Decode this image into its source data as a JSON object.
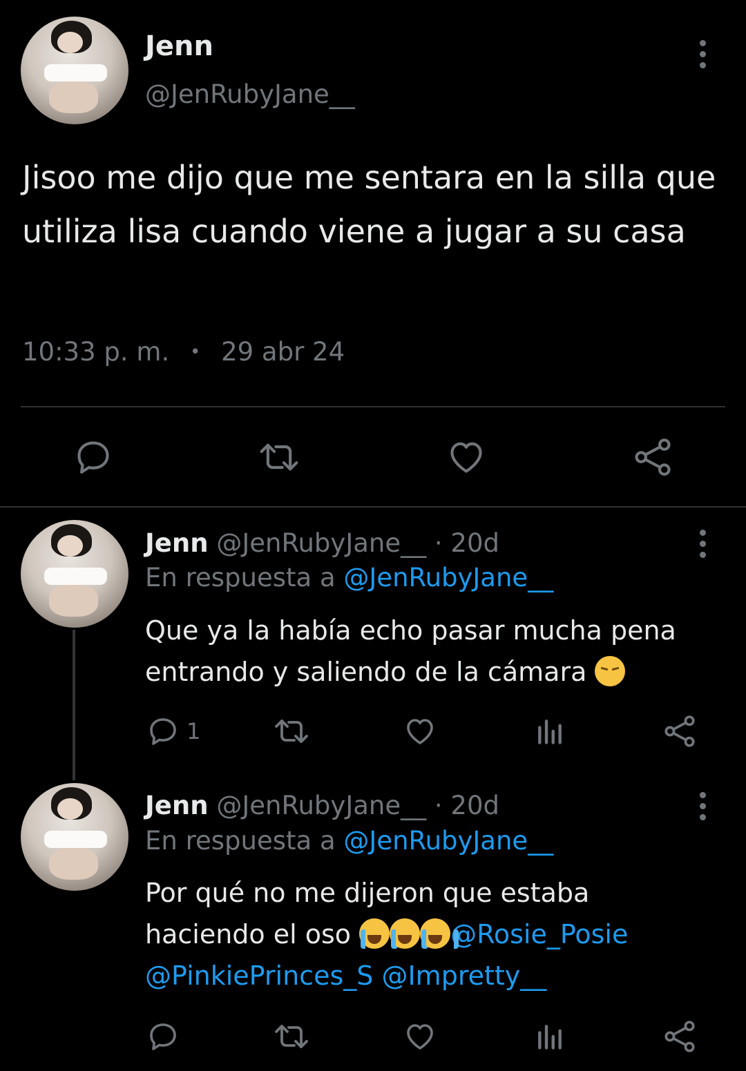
{
  "main_tweet": {
    "name": "Jenn",
    "handle": "@JenRubyJane__",
    "text": "Jisoo me dijo que me sentara en la silla que utiliza lisa cuando viene a jugar a su casa",
    "time": "10:33 p. m.",
    "separator": "•",
    "date": "29 abr 24",
    "actions": [
      "reply-icon",
      "retweet-icon",
      "like-icon",
      "share-icon"
    ]
  },
  "replies": [
    {
      "name": "Jenn",
      "handle": "@JenRubyJane__",
      "age": "· 20d",
      "replying_prefix": "En respuesta a",
      "replying_to": "@JenRubyJane__",
      "text": "Que ya la había echo pasar mucha pena entrando y saliendo de la cámara",
      "emoji": "pensive-face",
      "reply_count": "1",
      "actions": [
        "reply-icon",
        "retweet-icon",
        "like-icon",
        "views-icon",
        "share-icon"
      ]
    },
    {
      "name": "Jenn",
      "handle": "@JenRubyJane__",
      "age": "· 20d",
      "replying_prefix": "En respuesta a",
      "replying_to": "@JenRubyJane__",
      "text_line1": "Por qué no me dijeron que estaba",
      "text_line2": "haciendo el oso",
      "emoji": "loudly-crying-face",
      "mentions": [
        "@Rosie_Posie",
        "@PinkiePrinces_S",
        "@Impretty__"
      ],
      "actions": [
        "reply-icon",
        "retweet-icon",
        "like-icon",
        "views-icon",
        "share-icon"
      ]
    }
  ],
  "colors": {
    "background": "#000000",
    "text": "#e7e9ea",
    "secondary": "#71767b",
    "link": "#1d9bf0",
    "divider": "#2f3336"
  }
}
